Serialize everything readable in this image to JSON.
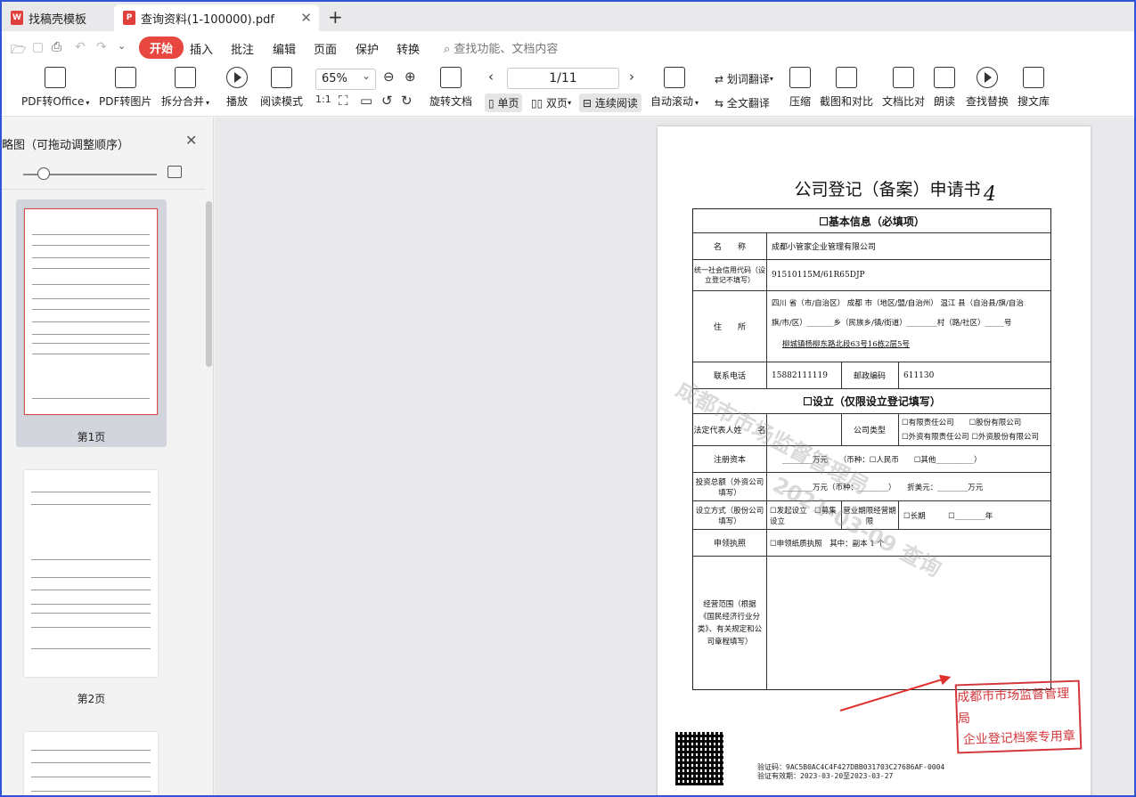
{
  "tabs": [
    {
      "label": "找稿壳模板"
    },
    {
      "label": "查询资料(1-100000).pdf"
    }
  ],
  "menu": {
    "items": [
      "开始",
      "插入",
      "批注",
      "编辑",
      "页面",
      "保护",
      "转换"
    ],
    "search_placeholder": "查找功能、文档内容"
  },
  "toolbar": {
    "pdf_to_office": "PDF转Office",
    "pdf_to_image": "PDF转图片",
    "split_merge": "拆分合并",
    "play": "播放",
    "read_mode": "阅读模式",
    "zoom": "65%",
    "rotate": "旋转文档",
    "page_indicator": "1/11",
    "single": "单页",
    "double": "双页",
    "continuous": "连续阅读",
    "autoscroll": "自动滚动",
    "word_translate": "划词翻译",
    "full_translate": "全文翻译",
    "compress": "压缩",
    "screenshot": "截图和对比",
    "compare": "文档比对",
    "read_aloud": "朗读",
    "find_replace": "查找替换",
    "search_lib": "搜文库"
  },
  "sidebar": {
    "title": "略图（可拖动调整顺序）",
    "thumbs": [
      {
        "label": "第1页"
      },
      {
        "label": "第2页"
      }
    ]
  },
  "document": {
    "title": "公司登记（备案）申请书",
    "hand_number": "4",
    "section1": "☐基本信息（必填项）",
    "name_label": "名　　称",
    "name_value": "成都小管家企业管理有限公司",
    "credit_label": "统一社会信用代码（设立登记不填写）",
    "credit_value": "91510115M/61R65DJP",
    "address_label": "住　　所",
    "address_line1": "四川 省（市/自治区） 成都 市（地区/盟/自治州） 温江 县（自治县/旗/自治",
    "address_line2": "旗/市/区）_______乡（民族乡/镇/街道）________村（路/社区）_____号",
    "address_line3": "柳城镇杨柳东路北段63号16栋2层5号",
    "phone_label": "联系电话",
    "phone_value": "15882111119",
    "postcode_label": "邮政编码",
    "postcode_value": "611130",
    "section2": "☐设立（仅限设立登记填写）",
    "legal_label": "法定代表人姓　　名",
    "type_label": "公司类型",
    "type_options1": "☐有限责任公司　　☐股份有限公司",
    "type_options2": "☐外资有限责任公司 ☐外资股份有限公司",
    "capital_label": "注册资本",
    "capital_value": "________万元　　（币种：☐人民币　　☐其他__________）",
    "invest_label": "投资总额（外资公司填写）",
    "invest_value": "________万元（币种：________）　　折美元：________万元",
    "method_label": "设立方式（股份公司填写）",
    "method_value": "☐发起设立　☐募集设立",
    "term_label": "营业期限经营期限",
    "term_value": "☐长期　　　☐________年",
    "license_label": "申领执照",
    "license_value": "☐申领纸质执照　其中：副本 1 个",
    "scope_label": "经营范围（根据《国民经济行业分类》、有关规定和公司章程填写）",
    "stamp_line1": "成都市市场监督管理局",
    "stamp_line2": "企业登记档案专用章",
    "verify_line1": "验证码：9AC5B0AC4C4F427DBB031703C27686AF-0004",
    "verify_line2": "验证有效期：2023-03-20至2023-03-27"
  }
}
